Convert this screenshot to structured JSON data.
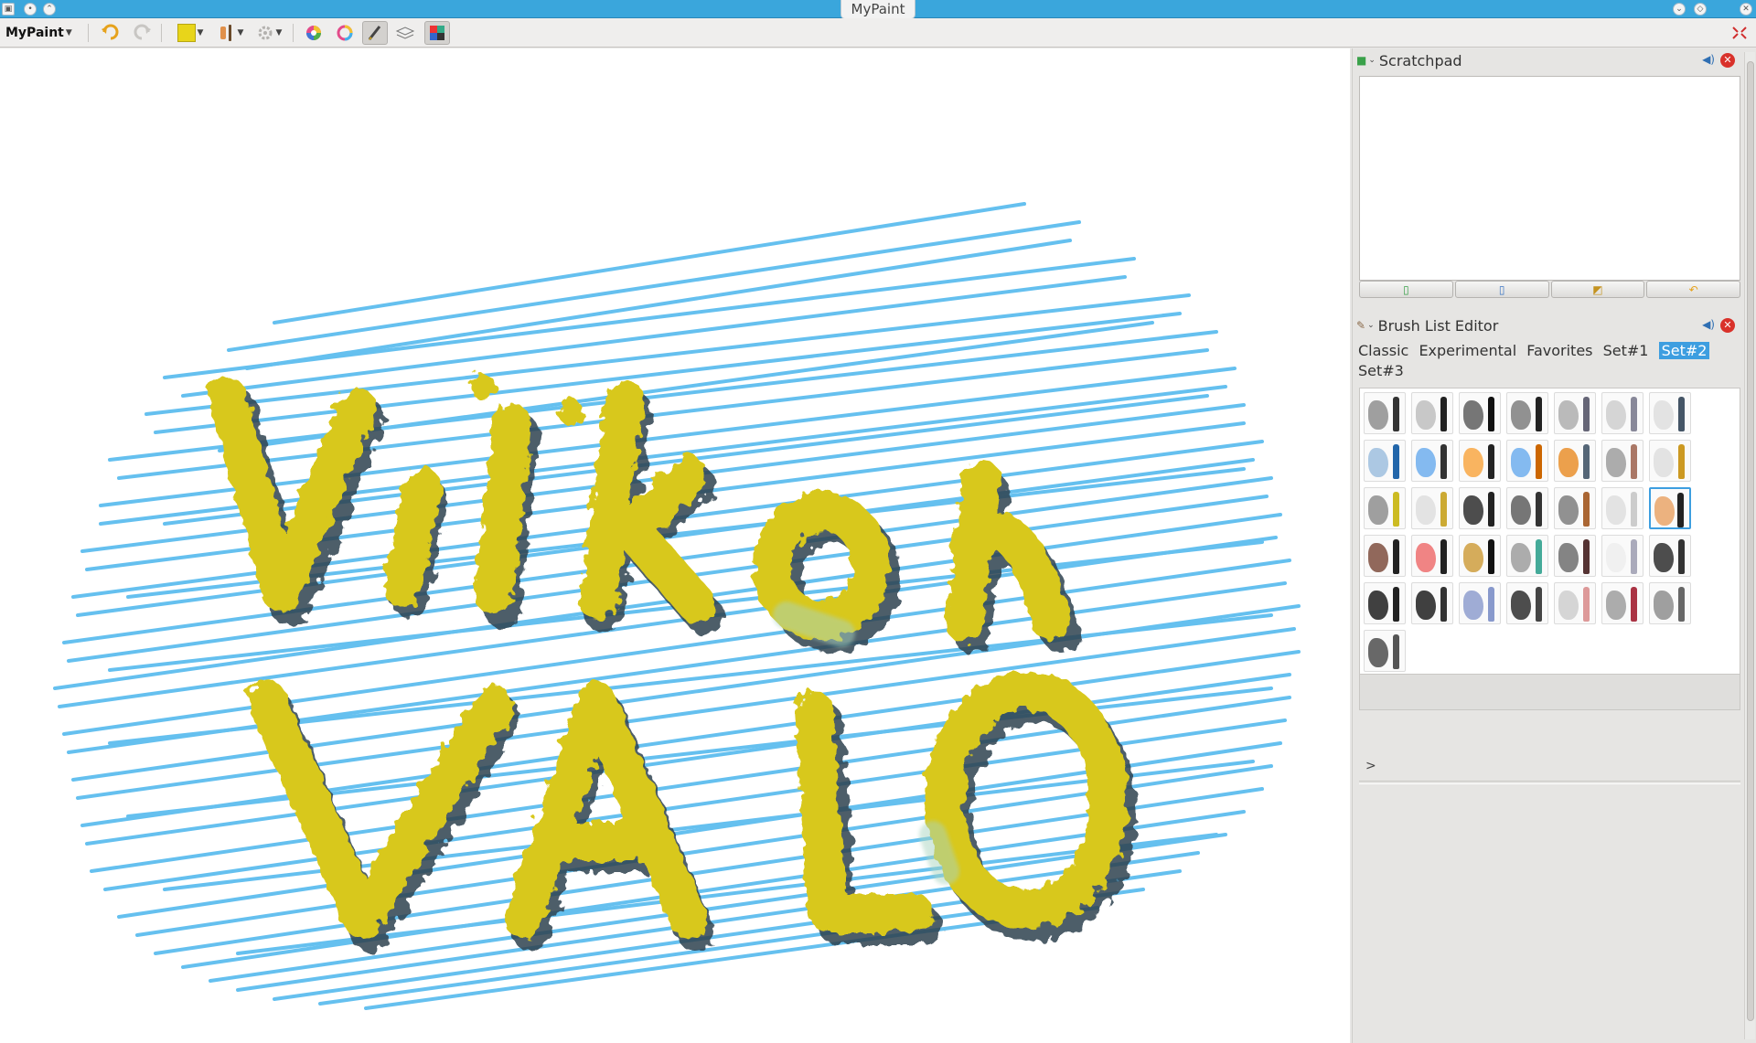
{
  "window": {
    "title": "MyPaint"
  },
  "toolbar": {
    "app_menu_label": "MyPaint",
    "items": [
      {
        "name": "undo-button",
        "icon": "undo-icon"
      },
      {
        "name": "redo-button",
        "icon": "redo-icon"
      },
      {
        "name": "color-button",
        "icon": "color-swatch",
        "color": "#e8d51a"
      },
      {
        "name": "brush-button",
        "icon": "brush-icon"
      },
      {
        "name": "settings-button",
        "icon": "gear-icon"
      },
      {
        "name": "color-wheel-button",
        "icon": "color-wheel-icon"
      },
      {
        "name": "color-ring-button",
        "icon": "color-ring-icon"
      },
      {
        "name": "freehand-tool-button",
        "icon": "freehand-icon"
      },
      {
        "name": "layers-button",
        "icon": "layers-icon"
      },
      {
        "name": "color-palette-button",
        "icon": "palette-icon"
      }
    ]
  },
  "canvas": {
    "background": "#ffffff",
    "scribble_color": "#3fb1ec",
    "text_line_1": "Viikon",
    "text_line_2": "VALO",
    "letter_color": "#d8c81c",
    "shadow_color": "#2f4250"
  },
  "scratchpad": {
    "title": "Scratchpad",
    "buttons": [
      "new-scratchpad-icon",
      "save-scratchpad-icon",
      "background-icon",
      "revert-icon"
    ]
  },
  "brush_list": {
    "title": "Brush List Editor",
    "sets": [
      {
        "label": "Classic",
        "active": false
      },
      {
        "label": "Experimental",
        "active": false
      },
      {
        "label": "Favorites",
        "active": false
      },
      {
        "label": "Set#1",
        "active": false
      },
      {
        "label": "Set#2",
        "active": true
      },
      {
        "label": "Set#3",
        "active": false
      }
    ],
    "brushes": [
      [
        "#888",
        "#333"
      ],
      [
        "#bbb",
        "#222"
      ],
      [
        "#555",
        "#111"
      ],
      [
        "#777",
        "#222"
      ],
      [
        "#aaa",
        "#667"
      ],
      [
        "#ccc",
        "#889"
      ],
      [
        "#ddd",
        "#456"
      ],
      [
        "#9bd",
        "#26a"
      ],
      [
        "#6ae",
        "#333"
      ],
      [
        "#f9a23a",
        "#222"
      ],
      [
        "#6ae",
        "#c60"
      ],
      [
        "#e98a20",
        "#567"
      ],
      [
        "#999",
        "#a76"
      ],
      [
        "#ddd",
        "#c92"
      ],
      [
        "#888",
        "#cb2"
      ],
      [
        "#ddd",
        "#ca3"
      ],
      [
        "#222",
        "#222"
      ],
      [
        "#555",
        "#333"
      ],
      [
        "#777",
        "#a63"
      ],
      [
        "#ddd",
        "#ccc"
      ],
      [
        "#e8a060",
        "#222"
      ],
      [
        "#743",
        "#222"
      ],
      [
        "#e66",
        "#222"
      ],
      [
        "#c93",
        "#111"
      ],
      [
        "#999",
        "#4a9"
      ],
      [
        "#666",
        "#533"
      ],
      [
        "#eee",
        "#aab"
      ],
      [
        "#222",
        "#333"
      ],
      [
        "#111",
        "#222"
      ],
      [
        "#111",
        "#333"
      ],
      [
        "#89c",
        "#89c"
      ],
      [
        "#222",
        "#444"
      ],
      [
        "#ccc",
        "#d99"
      ],
      [
        "#999",
        "#a34"
      ],
      [
        "#888",
        "#666"
      ],
      [
        "#444",
        "#555"
      ]
    ],
    "selected_index": 20,
    "expand_arrow": ">"
  }
}
